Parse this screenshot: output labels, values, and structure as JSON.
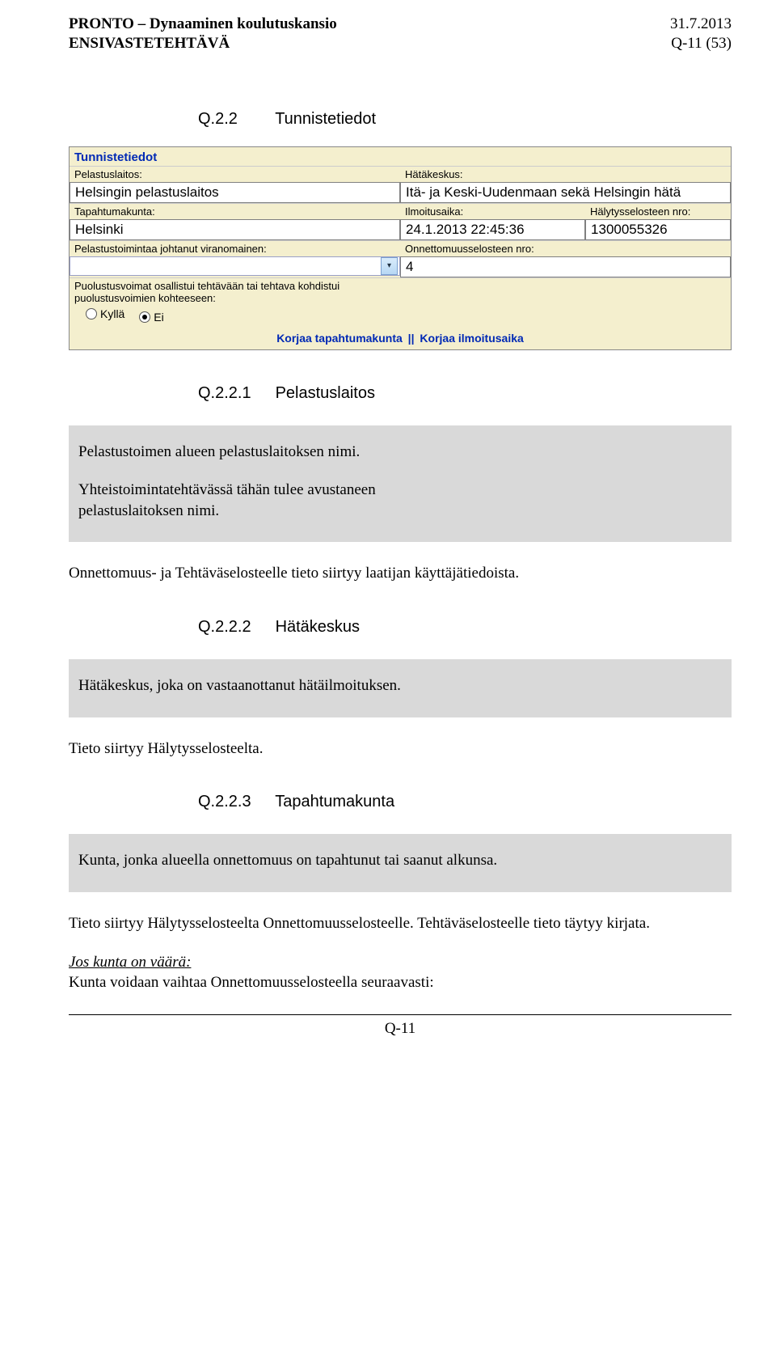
{
  "header": {
    "title_line1": "PRONTO – Dynaaminen koulutuskansio",
    "title_line2": "ENSIVASTETEHTÄVÄ",
    "date": "31.7.2013",
    "page_ref": "Q-11 (53)"
  },
  "sections": {
    "s1": {
      "num": "Q.2.2",
      "title": "Tunnistetiedot"
    },
    "s2": {
      "num": "Q.2.2.1",
      "title": "Pelastuslaitos"
    },
    "s3": {
      "num": "Q.2.2.2",
      "title": "Hätäkeskus"
    },
    "s4": {
      "num": "Q.2.2.3",
      "title": "Tapahtumakunta"
    }
  },
  "form": {
    "title": "Tunnistetiedot",
    "pelastuslaitos_lbl": "Pelastuslaitos:",
    "pelastuslaitos_val": "Helsingin pelastuslaitos",
    "hatakeskus_lbl": "Hätäkeskus:",
    "hatakeskus_val": "Itä- ja Keski-Uudenmaan sekä Helsingin hätä",
    "tapahtumakunta_lbl": "Tapahtumakunta:",
    "tapahtumakunta_val": "Helsinki",
    "ilmoitusaika_lbl": "Ilmoitusaika:",
    "ilmoitusaika_val": "24.1.2013 22:45:36",
    "halytysseloste_lbl": "Hälytysselosteen nro:",
    "halytysseloste_val": "1300055326",
    "viranomainen_lbl": "Pelastustoimintaa johtanut viranomainen:",
    "onnettomuus_nro_lbl": "Onnettomuusselosteen nro:",
    "onnettomuus_nro_val": "4",
    "puolustus_lbl1": "Puolustusvoimat osallistui tehtävään tai tehtava kohdistui",
    "puolustus_lbl2": "puolustusvoimien kohteeseen:",
    "radio_yes": "Kyllä",
    "radio_no": "Ei",
    "link1": "Korjaa tapahtumakunta",
    "link_sep": "||",
    "link2": "Korjaa ilmoitusaika"
  },
  "blocks": {
    "b1a": "Pelastustoimen alueen pelastuslaitoksen nimi.",
    "b1b": "Yhteistoimintatehtävässä tähän tulee avustaneen pelastuslaitoksen nimi.",
    "p1": "Onnettomuus- ja Tehtäväselosteelle tieto siirtyy laatijan käyttäjätiedoista.",
    "b2": "Hätäkeskus, joka on vastaanottanut hätäilmoituksen.",
    "p2": "Tieto siirtyy Hälytysselosteelta.",
    "b3": "Kunta, jonka alueella onnettomuus on tapahtunut tai saanut alkunsa.",
    "p3": "Tieto siirtyy Hälytysselosteelta Onnettomuusselosteelle. Tehtäväselosteelle tieto täytyy kirjata.",
    "p4_u": "Jos kunta on väärä:",
    "p4_rest": "Kunta voidaan vaihtaa Onnettomuusselosteella seuraavasti:"
  },
  "footer": "Q-11"
}
